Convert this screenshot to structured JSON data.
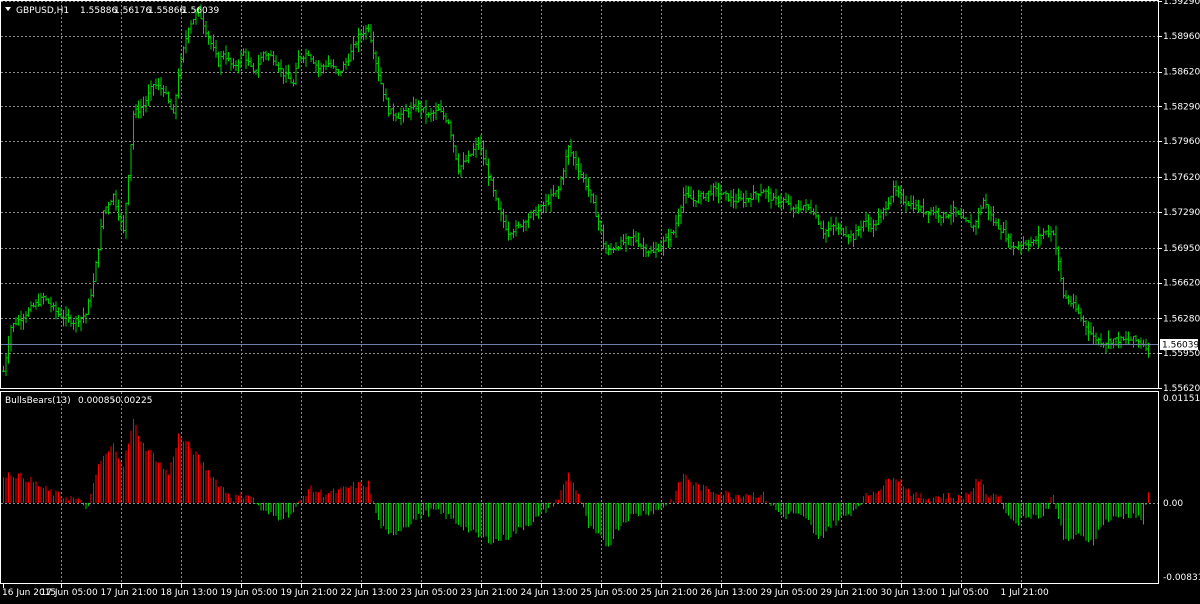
{
  "chart_data": [
    {
      "type": "ohlc",
      "title": "GBPUSD,H1",
      "ohlc_readout": [
        "1.55886",
        "1.56176",
        "1.55866",
        "1.56039"
      ],
      "current_price": 1.56039,
      "current_price_label": "1.56039",
      "ylim": [
        1.5562,
        1.5929
      ],
      "y_ticks": [
        "1.59290",
        "1.58960",
        "1.58620",
        "1.58290",
        "1.57960",
        "1.57620",
        "1.57290",
        "1.56950",
        "1.56620",
        "1.56280",
        "1.55950",
        "1.55620"
      ],
      "grid": true,
      "bar_color": "#00cc00",
      "price_line_color": "#6e7fa8",
      "anchors": [
        [
          0,
          1.5578
        ],
        [
          3,
          1.562
        ],
        [
          10,
          1.5635
        ],
        [
          16,
          1.5648
        ],
        [
          22,
          1.5632
        ],
        [
          28,
          1.5625
        ],
        [
          33,
          1.5632
        ],
        [
          36,
          1.5662
        ],
        [
          40,
          1.573
        ],
        [
          44,
          1.5745
        ],
        [
          48,
          1.571
        ],
        [
          52,
          1.5822
        ],
        [
          56,
          1.583
        ],
        [
          60,
          1.585
        ],
        [
          64,
          1.5845
        ],
        [
          68,
          1.582
        ],
        [
          70,
          1.586
        ],
        [
          74,
          1.5905
        ],
        [
          78,
          1.592
        ],
        [
          82,
          1.5895
        ],
        [
          86,
          1.587
        ],
        [
          88,
          1.588
        ],
        [
          92,
          1.5865
        ],
        [
          96,
          1.588
        ],
        [
          100,
          1.586
        ],
        [
          104,
          1.588
        ],
        [
          108,
          1.5875
        ],
        [
          112,
          1.586
        ],
        [
          116,
          1.585
        ],
        [
          118,
          1.5875
        ],
        [
          122,
          1.588
        ],
        [
          126,
          1.5865
        ],
        [
          130,
          1.587
        ],
        [
          134,
          1.586
        ],
        [
          138,
          1.5875
        ],
        [
          142,
          1.5895
        ],
        [
          146,
          1.5905
        ],
        [
          150,
          1.586
        ],
        [
          154,
          1.5825
        ],
        [
          158,
          1.582
        ],
        [
          162,
          1.5825
        ],
        [
          166,
          1.583
        ],
        [
          170,
          1.582
        ],
        [
          174,
          1.5825
        ],
        [
          178,
          1.5815
        ],
        [
          182,
          1.577
        ],
        [
          186,
          1.578
        ],
        [
          190,
          1.5795
        ],
        [
          194,
          1.5765
        ],
        [
          198,
          1.573
        ],
        [
          202,
          1.571
        ],
        [
          206,
          1.5715
        ],
        [
          210,
          1.5725
        ],
        [
          214,
          1.573
        ],
        [
          218,
          1.574
        ],
        [
          222,
          1.575
        ],
        [
          226,
          1.579
        ],
        [
          230,
          1.577
        ],
        [
          234,
          1.575
        ],
        [
          238,
          1.572
        ],
        [
          241,
          1.569
        ],
        [
          244,
          1.5695
        ],
        [
          248,
          1.57
        ],
        [
          252,
          1.5705
        ],
        [
          256,
          1.5695
        ],
        [
          260,
          1.569
        ],
        [
          264,
          1.57
        ],
        [
          268,
          1.571
        ],
        [
          272,
          1.5745
        ],
        [
          276,
          1.574
        ],
        [
          280,
          1.5745
        ],
        [
          284,
          1.575
        ],
        [
          288,
          1.5745
        ],
        [
          292,
          1.574
        ],
        [
          296,
          1.574
        ],
        [
          300,
          1.5745
        ],
        [
          304,
          1.575
        ],
        [
          308,
          1.574
        ],
        [
          312,
          1.574
        ],
        [
          316,
          1.573
        ],
        [
          320,
          1.5735
        ],
        [
          324,
          1.573
        ],
        [
          328,
          1.571
        ],
        [
          332,
          1.5715
        ],
        [
          336,
          1.571
        ],
        [
          340,
          1.5705
        ],
        [
          344,
          1.572
        ],
        [
          348,
          1.5715
        ],
        [
          352,
          1.573
        ],
        [
          356,
          1.575
        ],
        [
          360,
          1.574
        ],
        [
          364,
          1.5735
        ],
        [
          368,
          1.573
        ],
        [
          372,
          1.573
        ],
        [
          376,
          1.5725
        ],
        [
          380,
          1.573
        ],
        [
          384,
          1.572
        ],
        [
          388,
          1.5715
        ],
        [
          392,
          1.574
        ],
        [
          396,
          1.572
        ],
        [
          400,
          1.571
        ],
        [
          404,
          1.5695
        ],
        [
          408,
          1.57
        ],
        [
          412,
          1.57
        ],
        [
          416,
          1.571
        ],
        [
          420,
          1.571
        ],
        [
          424,
          1.565
        ],
        [
          428,
          1.564
        ],
        [
          432,
          1.5625
        ],
        [
          436,
          1.561
        ],
        [
          440,
          1.5605
        ],
        [
          444,
          1.5608
        ],
        [
          448,
          1.5607
        ],
        [
          452,
          1.5608
        ],
        [
          456,
          1.5604
        ],
        [
          458,
          1.56
        ]
      ]
    },
    {
      "type": "histogram",
      "indicator_name": "BullsBears(13)",
      "values_readout": [
        "0.00085",
        "-0.00225"
      ],
      "ylim": [
        -0.00831,
        0.01151
      ],
      "y_ticks": [
        "0.01151",
        "0.00",
        "-0.00831"
      ],
      "up_color": "#00cc00",
      "down_color": "#ff0000",
      "anchors": [
        [
          0,
          0.003
        ],
        [
          4,
          0.003
        ],
        [
          10,
          0.0025
        ],
        [
          16,
          0.0015
        ],
        [
          22,
          0.0008
        ],
        [
          28,
          0.0005
        ],
        [
          34,
          -0.0005
        ],
        [
          38,
          0.004
        ],
        [
          44,
          0.006
        ],
        [
          48,
          0.004
        ],
        [
          52,
          0.0085
        ],
        [
          56,
          0.006
        ],
        [
          60,
          0.005
        ],
        [
          66,
          0.003
        ],
        [
          70,
          0.007
        ],
        [
          74,
          0.006
        ],
        [
          80,
          0.004
        ],
        [
          86,
          0.002
        ],
        [
          92,
          0.0005
        ],
        [
          98,
          0.001
        ],
        [
          104,
          -0.001
        ],
        [
          110,
          -0.0015
        ],
        [
          116,
          -0.001
        ],
        [
          122,
          0.0015
        ],
        [
          128,
          0.001
        ],
        [
          134,
          0.0012
        ],
        [
          140,
          0.0018
        ],
        [
          146,
          0.002
        ],
        [
          150,
          -0.002
        ],
        [
          154,
          -0.0035
        ],
        [
          160,
          -0.0025
        ],
        [
          166,
          -0.0015
        ],
        [
          172,
          -0.0008
        ],
        [
          178,
          -0.0015
        ],
        [
          184,
          -0.0025
        ],
        [
          190,
          -0.0035
        ],
        [
          196,
          -0.004
        ],
        [
          202,
          -0.0035
        ],
        [
          208,
          -0.0025
        ],
        [
          214,
          -0.0015
        ],
        [
          218,
          -0.0005
        ],
        [
          222,
          0.0005
        ],
        [
          226,
          0.003
        ],
        [
          230,
          0.001
        ],
        [
          234,
          -0.0025
        ],
        [
          238,
          -0.0035
        ],
        [
          242,
          -0.0045
        ],
        [
          246,
          -0.0025
        ],
        [
          250,
          -0.0015
        ],
        [
          256,
          -0.001
        ],
        [
          262,
          -0.0008
        ],
        [
          268,
          0.0005
        ],
        [
          272,
          0.003
        ],
        [
          276,
          0.002
        ],
        [
          280,
          0.0015
        ],
        [
          286,
          0.0012
        ],
        [
          292,
          0.0008
        ],
        [
          298,
          0.001
        ],
        [
          304,
          0.0008
        ],
        [
          308,
          -0.0005
        ],
        [
          312,
          -0.0015
        ],
        [
          316,
          -0.001
        ],
        [
          322,
          -0.002
        ],
        [
          326,
          -0.004
        ],
        [
          330,
          -0.0025
        ],
        [
          336,
          -0.0015
        ],
        [
          340,
          -0.0008
        ],
        [
          344,
          0.0005
        ],
        [
          348,
          0.0012
        ],
        [
          352,
          0.0018
        ],
        [
          356,
          0.003
        ],
        [
          360,
          0.002
        ],
        [
          364,
          0.0008
        ],
        [
          370,
          0.0005
        ],
        [
          376,
          0.0008
        ],
        [
          382,
          0.0005
        ],
        [
          386,
          0.001
        ],
        [
          390,
          0.0025
        ],
        [
          394,
          0.0008
        ],
        [
          398,
          0.001
        ],
        [
          402,
          -0.0015
        ],
        [
          406,
          -0.002
        ],
        [
          410,
          -0.0012
        ],
        [
          416,
          -0.0015
        ],
        [
          420,
          0.001
        ],
        [
          424,
          -0.004
        ],
        [
          430,
          -0.0035
        ],
        [
          436,
          -0.004
        ],
        [
          440,
          -0.002
        ],
        [
          446,
          -0.0015
        ],
        [
          452,
          -0.0012
        ],
        [
          456,
          -0.002
        ],
        [
          458,
          0.0008
        ]
      ]
    }
  ],
  "x_axis": {
    "labels": [
      {
        "bar": 0,
        "text": "16 Jun 2015"
      },
      {
        "bar": 23,
        "text": "17 Jun 05:00"
      },
      {
        "bar": 47,
        "text": "17 Jun 21:00"
      },
      {
        "bar": 71,
        "text": "18 Jun 13:00"
      },
      {
        "bar": 95,
        "text": "19 Jun 05:00"
      },
      {
        "bar": 119,
        "text": "19 Jun 21:00"
      },
      {
        "bar": 143,
        "text": "22 Jun 13:00"
      },
      {
        "bar": 167,
        "text": "23 Jun 05:00"
      },
      {
        "bar": 191,
        "text": "23 Jun 21:00"
      },
      {
        "bar": 215,
        "text": "24 Jun 13:00"
      },
      {
        "bar": 239,
        "text": "25 Jun 05:00"
      },
      {
        "bar": 263,
        "text": "25 Jun 21:00"
      },
      {
        "bar": 287,
        "text": "26 Jun 13:00"
      },
      {
        "bar": 311,
        "text": "29 Jun 05:00"
      },
      {
        "bar": 335,
        "text": "29 Jun 21:00"
      },
      {
        "bar": 359,
        "text": "30 Jun 13:00"
      },
      {
        "bar": 383,
        "text": "1 Jul 05:00"
      },
      {
        "bar": 407,
        "text": "1 Jul 21:00"
      }
    ]
  },
  "colors": {
    "background": "#000000",
    "grid": "#8c8c8c",
    "axis_text": "#ffffff",
    "frame": "#ffffff"
  }
}
